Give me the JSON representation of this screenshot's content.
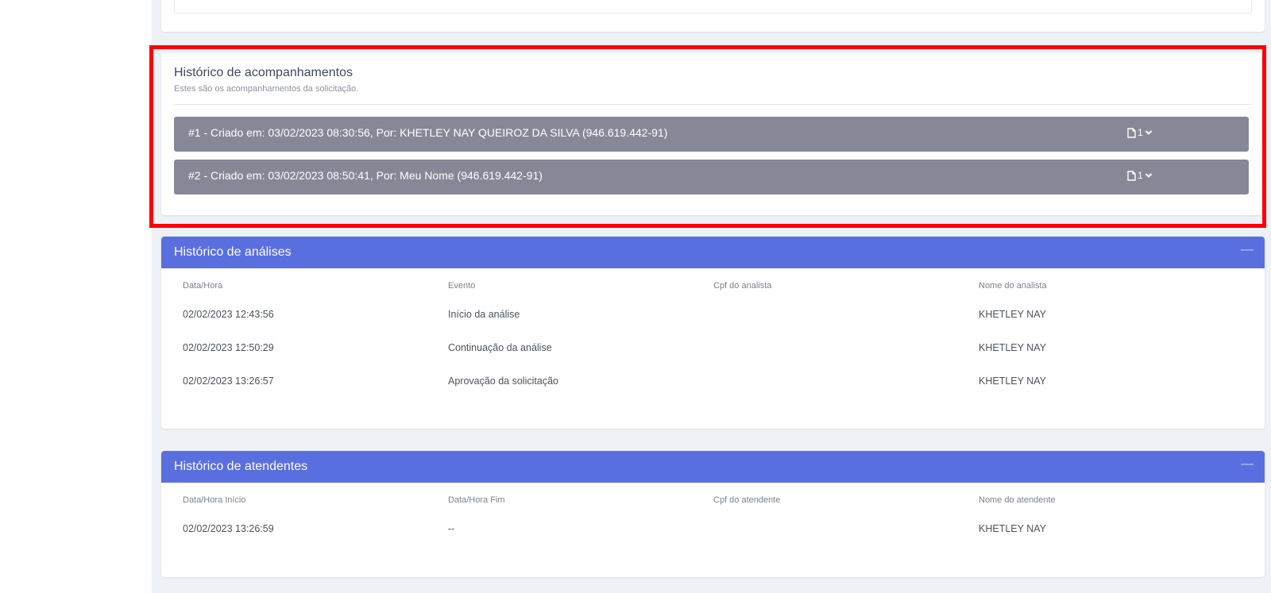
{
  "colors": {
    "accent": "#5a6fdf",
    "accordion": "#878897",
    "highlight": "#ff0000",
    "page_bg": "#eef1f6"
  },
  "acompanhamentos": {
    "title": "Histórico de acompanhamentos",
    "subtitle": "Estes são os acompanhamentos da solicitação.",
    "items": [
      {
        "label": "#1 - Criado em: 03/02/2023 08:30:56, Por: KHETLEY NAY QUEIROZ DA SILVA (946.619.442-91)",
        "count": "1",
        "icon": "document-icon"
      },
      {
        "label": "#2 - Criado em: 03/02/2023 08:50:41, Por: Meu Nome (946.619.442-91)",
        "count": "1",
        "icon": "document-icon"
      }
    ]
  },
  "analises": {
    "title": "Histórico de análises",
    "collapse": "—",
    "columns": [
      "Data/Hora",
      "Evento",
      "Cpf do analista",
      "Nome do analista"
    ],
    "rows": [
      [
        "02/02/2023 12:43:56",
        "Início da análise",
        "",
        "KHETLEY NAY"
      ],
      [
        "02/02/2023 12:50:29",
        "Continuação da análise",
        "",
        "KHETLEY NAY"
      ],
      [
        "02/02/2023 13:26:57",
        "Aprovação da solicitação",
        "",
        "KHETLEY NAY"
      ]
    ]
  },
  "atendentes": {
    "title": "Histórico de atendentes",
    "collapse": "—",
    "columns": [
      "Data/Hora Início",
      "Data/Hora Fim",
      "Cpf do atendente",
      "Nome do atendente"
    ],
    "rows": [
      [
        "02/02/2023 13:26:59",
        "--",
        "",
        "KHETLEY NAY"
      ]
    ]
  }
}
